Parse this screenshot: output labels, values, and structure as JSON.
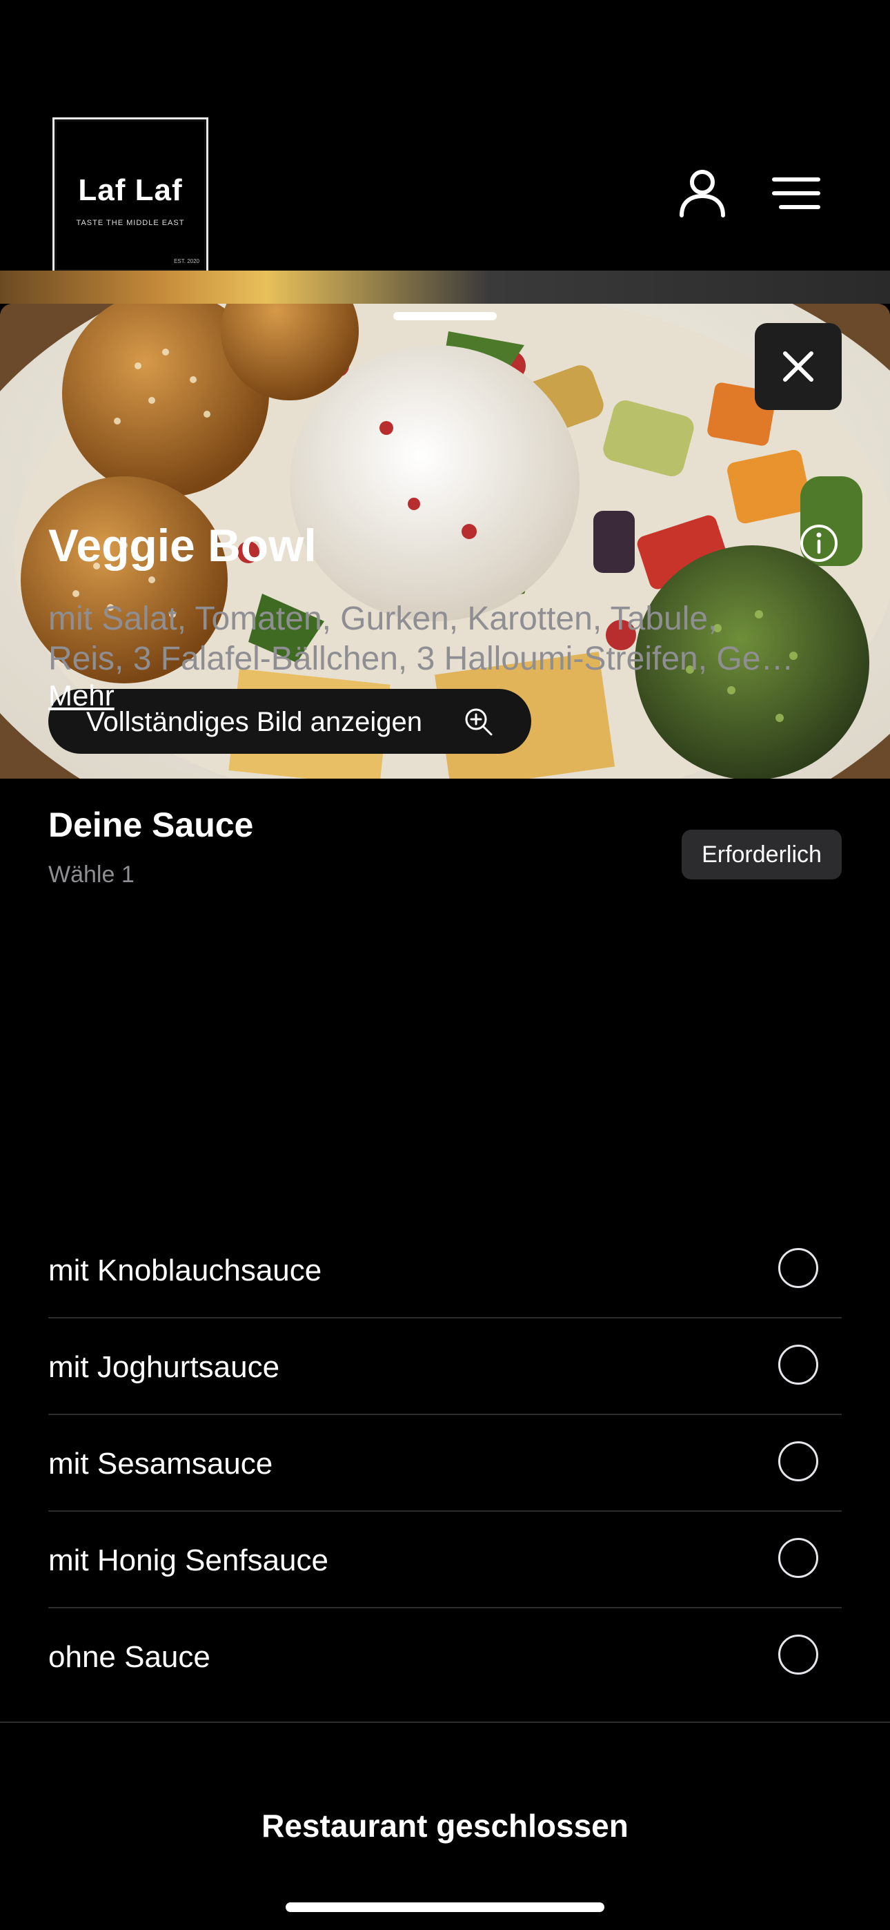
{
  "header": {
    "logo": {
      "text": "Laf Laf",
      "tagline": "TASTE THE MIDDLE EAST",
      "est": "EST. 2020"
    },
    "profile_icon": "person-icon",
    "menu_icon": "hamburger-menu-icon"
  },
  "photo": {
    "view_full_label": "Vollständiges Bild anzeigen",
    "zoom_icon": "zoom-in-icon",
    "close_icon": "close-icon"
  },
  "item": {
    "title": "Veggie Bowl",
    "desc_line1": "mit Salat, Tomaten, Gurken, Karotten, Tabule,",
    "desc_line2": "Reis, 3 Falafel-Bällchen, 3 Halloumi-Streifen, Ge…",
    "more_label": "Mehr",
    "info_icon": "info-icon"
  },
  "sauce": {
    "title": "Deine Sauce",
    "subtitle": "Wähle 1",
    "required_label": "Erforderlich",
    "options": [
      {
        "label": "mit Knoblauchsauce",
        "selected": false
      },
      {
        "label": "mit Joghurtsauce",
        "selected": false
      },
      {
        "label": "mit Sesamsauce",
        "selected": false
      },
      {
        "label": "mit Honig Senfsauce",
        "selected": false
      },
      {
        "label": "ohne Sauce",
        "selected": false
      }
    ]
  },
  "footer": {
    "status_label": "Restaurant geschlossen"
  }
}
